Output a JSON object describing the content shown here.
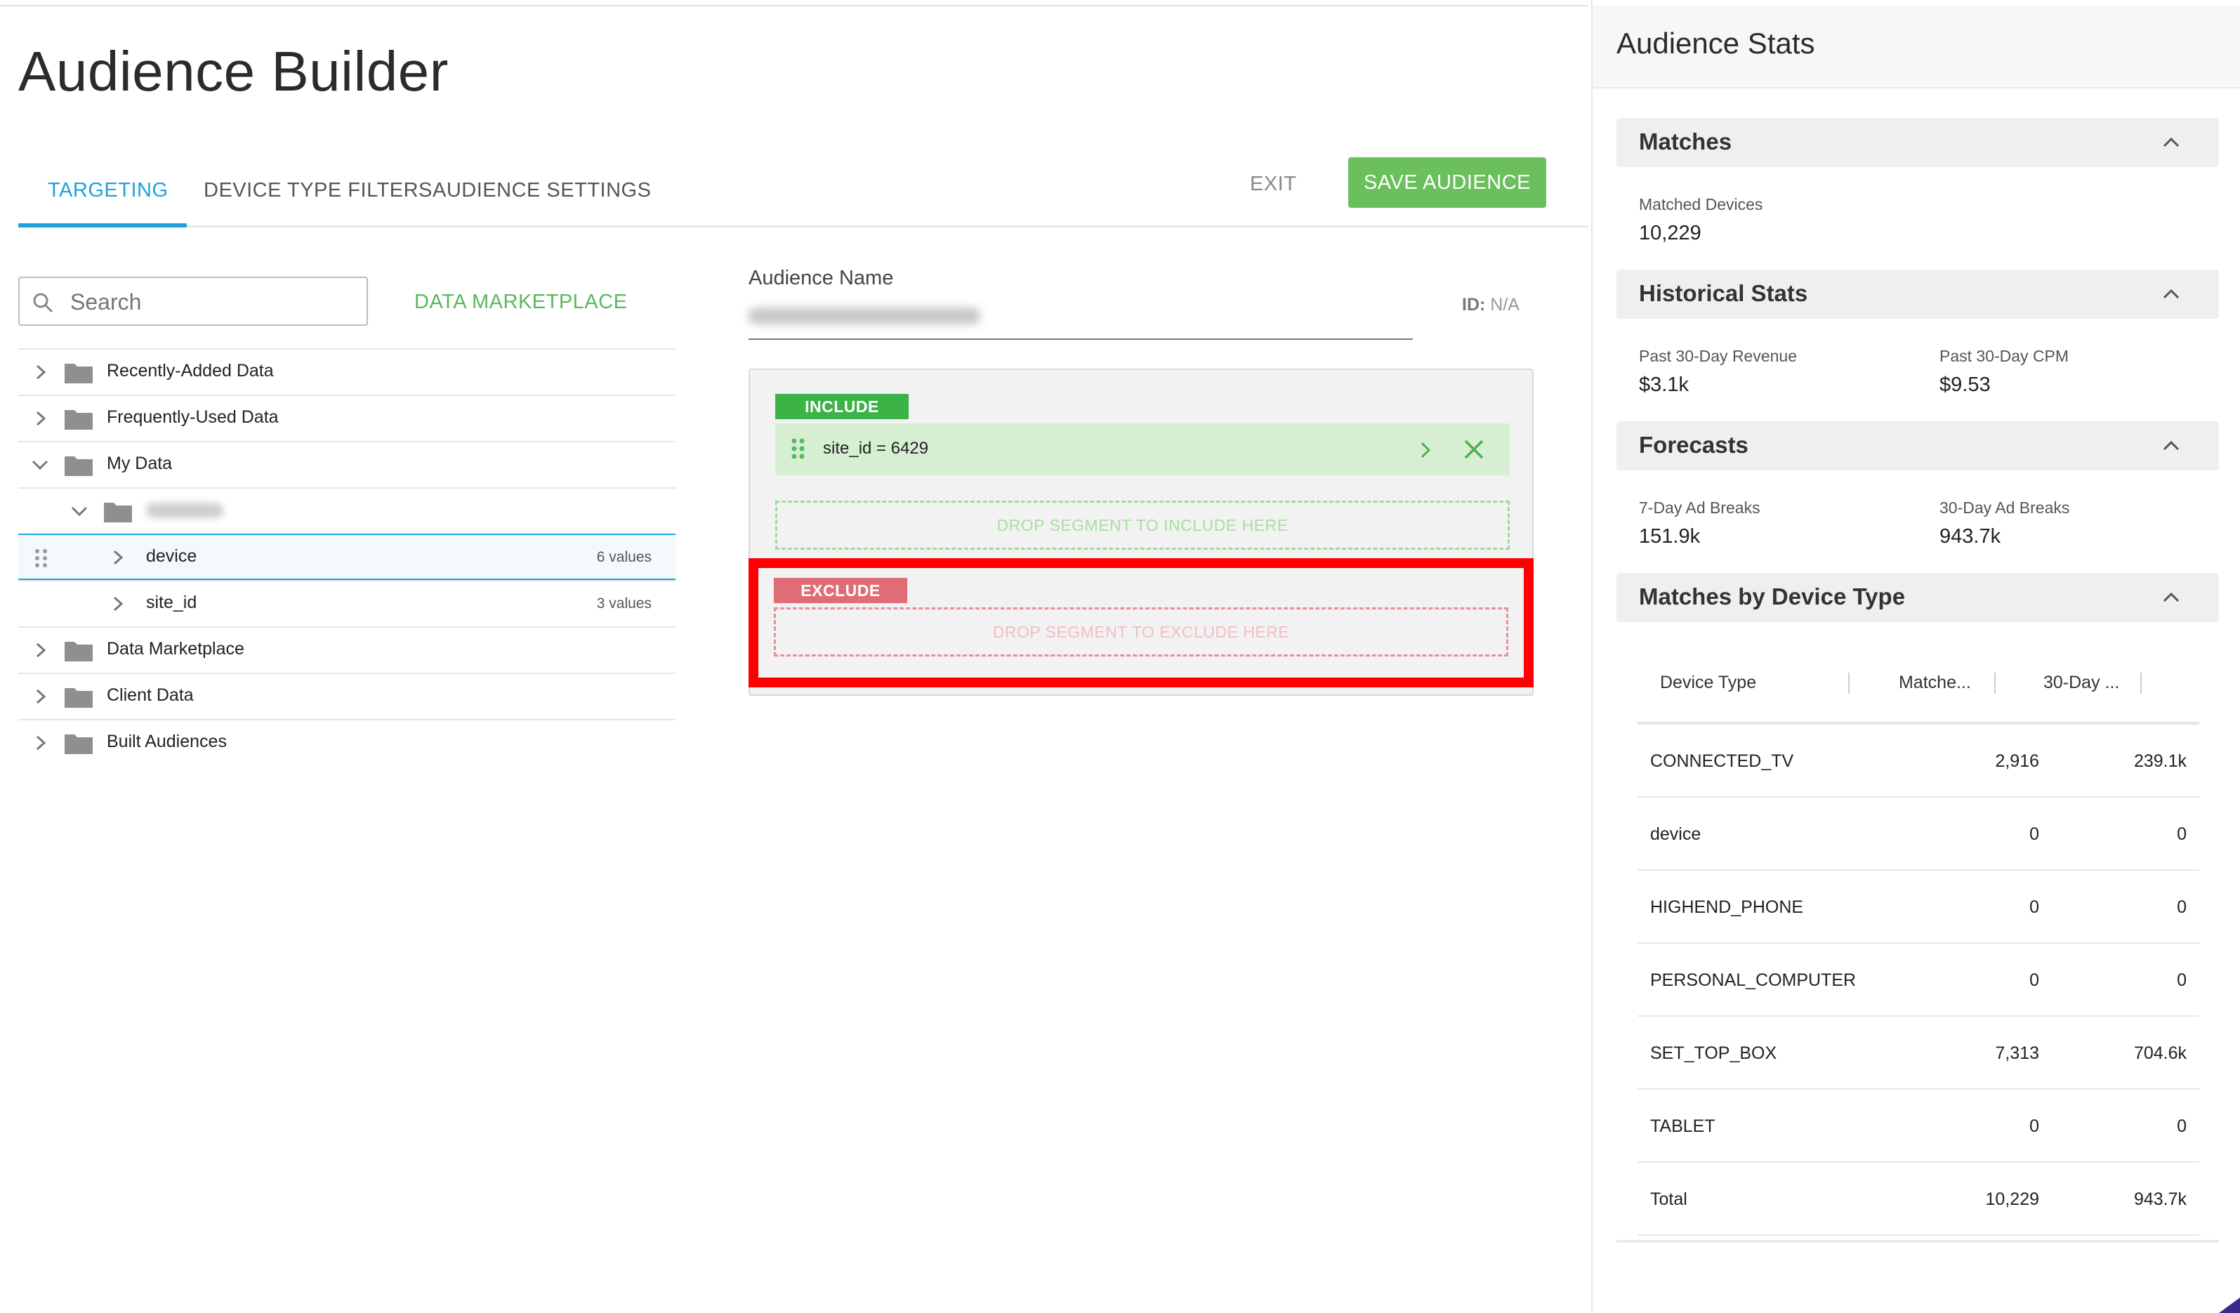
{
  "app": {
    "title": "Audience Builder",
    "tabs": [
      {
        "label": "TARGETING",
        "active": true
      },
      {
        "label": "DEVICE TYPE FILTERS",
        "active": false
      },
      {
        "label": "AUDIENCE SETTINGS",
        "active": false
      }
    ],
    "exit_label": "EXIT",
    "save_label": "SAVE AUDIENCE"
  },
  "left": {
    "search_placeholder": "Search",
    "data_marketplace_link": "DATA MARKETPLACE",
    "tree": [
      {
        "label": "Recently-Added Data",
        "expanded": false
      },
      {
        "label": "Frequently-Used Data",
        "expanded": false
      },
      {
        "label": "My Data",
        "expanded": true
      },
      {
        "label": "device",
        "values": "6 values",
        "selected": true
      },
      {
        "label": "site_id",
        "values": "3 values"
      },
      {
        "label": "Data Marketplace",
        "expanded": false
      },
      {
        "label": "Client Data",
        "expanded": false
      },
      {
        "label": "Built Audiences",
        "expanded": false
      }
    ]
  },
  "builder": {
    "audience_name_label": "Audience Name",
    "id_label": "ID:",
    "id_value": "N/A",
    "include_tag": "INCLUDE",
    "include_segment": "site_id = 6429",
    "drop_include": "DROP SEGMENT TO INCLUDE HERE",
    "exclude_tag": "EXCLUDE",
    "drop_exclude": "DROP SEGMENT TO EXCLUDE HERE"
  },
  "stats": {
    "title": "Audience Stats",
    "matches": {
      "title": "Matches",
      "matched_devices_label": "Matched Devices",
      "matched_devices_value": "10,229"
    },
    "historical": {
      "title": "Historical Stats",
      "revenue_label": "Past 30-Day Revenue",
      "revenue_value": "$3.1k",
      "cpm_label": "Past 30-Day CPM",
      "cpm_value": "$9.53"
    },
    "forecasts": {
      "title": "Forecasts",
      "ad7_label": "7-Day Ad Breaks",
      "ad7_value": "151.9k",
      "ad30_label": "30-Day Ad Breaks",
      "ad30_value": "943.7k"
    },
    "device_type": {
      "title": "Matches by Device Type",
      "headers": [
        "Device Type",
        "Matche...",
        "30-Day ..."
      ],
      "rows": [
        [
          "CONNECTED_TV",
          "2,916",
          "239.1k"
        ],
        [
          "device",
          "0",
          "0"
        ],
        [
          "HIGHEND_PHONE",
          "0",
          "0"
        ],
        [
          "PERSONAL_COMPUTER",
          "0",
          "0"
        ],
        [
          "SET_TOP_BOX",
          "7,313",
          "704.6k"
        ],
        [
          "TABLET",
          "0",
          "0"
        ],
        [
          "Total",
          "10,229",
          "943.7k"
        ]
      ]
    }
  },
  "colors": {
    "accent_blue": "#1fa1db",
    "save_green": "#6bbf5c",
    "include_green": "#3cb346",
    "exclude_red": "#e06c76",
    "highlight_red": "#ff0000"
  },
  "icons": {
    "search": "search-icon",
    "folder": "folder-icon",
    "chevron": "chevron-right-icon",
    "drag": "drag-handle-icon",
    "close": "close-icon",
    "collapse": "chevron-up-icon",
    "settings": "gear-icon"
  }
}
